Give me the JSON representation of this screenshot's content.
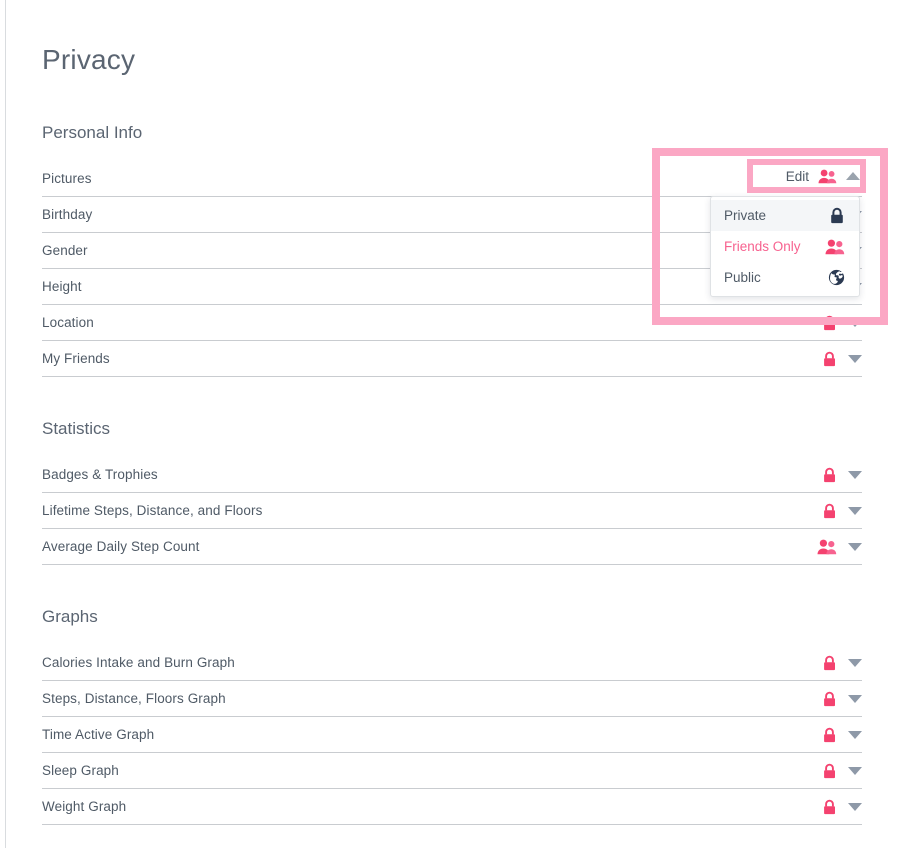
{
  "page": {
    "title": "Privacy"
  },
  "sections": [
    {
      "title": "Personal Info",
      "rows": [
        {
          "label": "Pictures",
          "visibility": "friends",
          "icon": "friends-icon",
          "caret": "caret-up-icon"
        },
        {
          "label": "Birthday",
          "visibility": "private",
          "icon": "lock-icon",
          "caret": "caret-down-icon"
        },
        {
          "label": "Gender",
          "visibility": "private",
          "icon": "lock-icon",
          "caret": "caret-down-icon"
        },
        {
          "label": "Height",
          "visibility": "private",
          "icon": "lock-icon",
          "caret": "caret-down-icon"
        },
        {
          "label": "Location",
          "visibility": "private",
          "icon": "lock-icon",
          "caret": "caret-down-icon"
        },
        {
          "label": "My Friends",
          "visibility": "private",
          "icon": "lock-icon",
          "caret": "caret-down-icon"
        }
      ]
    },
    {
      "title": "Statistics",
      "rows": [
        {
          "label": "Badges & Trophies",
          "visibility": "private",
          "icon": "lock-icon",
          "caret": "caret-down-icon"
        },
        {
          "label": "Lifetime Steps, Distance, and Floors",
          "visibility": "private",
          "icon": "lock-icon",
          "caret": "caret-down-icon"
        },
        {
          "label": "Average Daily Step Count",
          "visibility": "friends",
          "icon": "friends-icon",
          "caret": "caret-down-icon"
        }
      ]
    },
    {
      "title": "Graphs",
      "rows": [
        {
          "label": "Calories Intake and Burn Graph",
          "visibility": "private",
          "icon": "lock-icon",
          "caret": "caret-down-icon"
        },
        {
          "label": "Steps, Distance, Floors Graph",
          "visibility": "private",
          "icon": "lock-icon",
          "caret": "caret-down-icon"
        },
        {
          "label": "Time Active Graph",
          "visibility": "private",
          "icon": "lock-icon",
          "caret": "caret-down-icon"
        },
        {
          "label": "Sleep Graph",
          "visibility": "private",
          "icon": "lock-icon",
          "caret": "caret-down-icon"
        },
        {
          "label": "Weight Graph",
          "visibility": "private",
          "icon": "lock-icon",
          "caret": "caret-down-icon"
        }
      ]
    }
  ],
  "edit_control": {
    "label": "Edit",
    "icon": "friends-icon",
    "caret": "caret-up-icon",
    "expanded": true,
    "highlight_color": "#fba7c4"
  },
  "dropdown": {
    "open": true,
    "selected": "Friends Only",
    "hovered": "Private",
    "options": [
      {
        "label": "Private",
        "icon": "lock-icon",
        "state": "hovered"
      },
      {
        "label": "Friends Only",
        "icon": "friends-icon",
        "state": "selected"
      },
      {
        "label": "Public",
        "icon": "globe-icon",
        "state": "normal"
      }
    ]
  },
  "colors": {
    "accent_pink": "#f7628f",
    "lock_pink": "#f4426f",
    "highlight_pink": "#fba7c4",
    "dark_icon": "#2b3a52",
    "text": "#4f5a66",
    "rule": "#c9ccd0"
  }
}
